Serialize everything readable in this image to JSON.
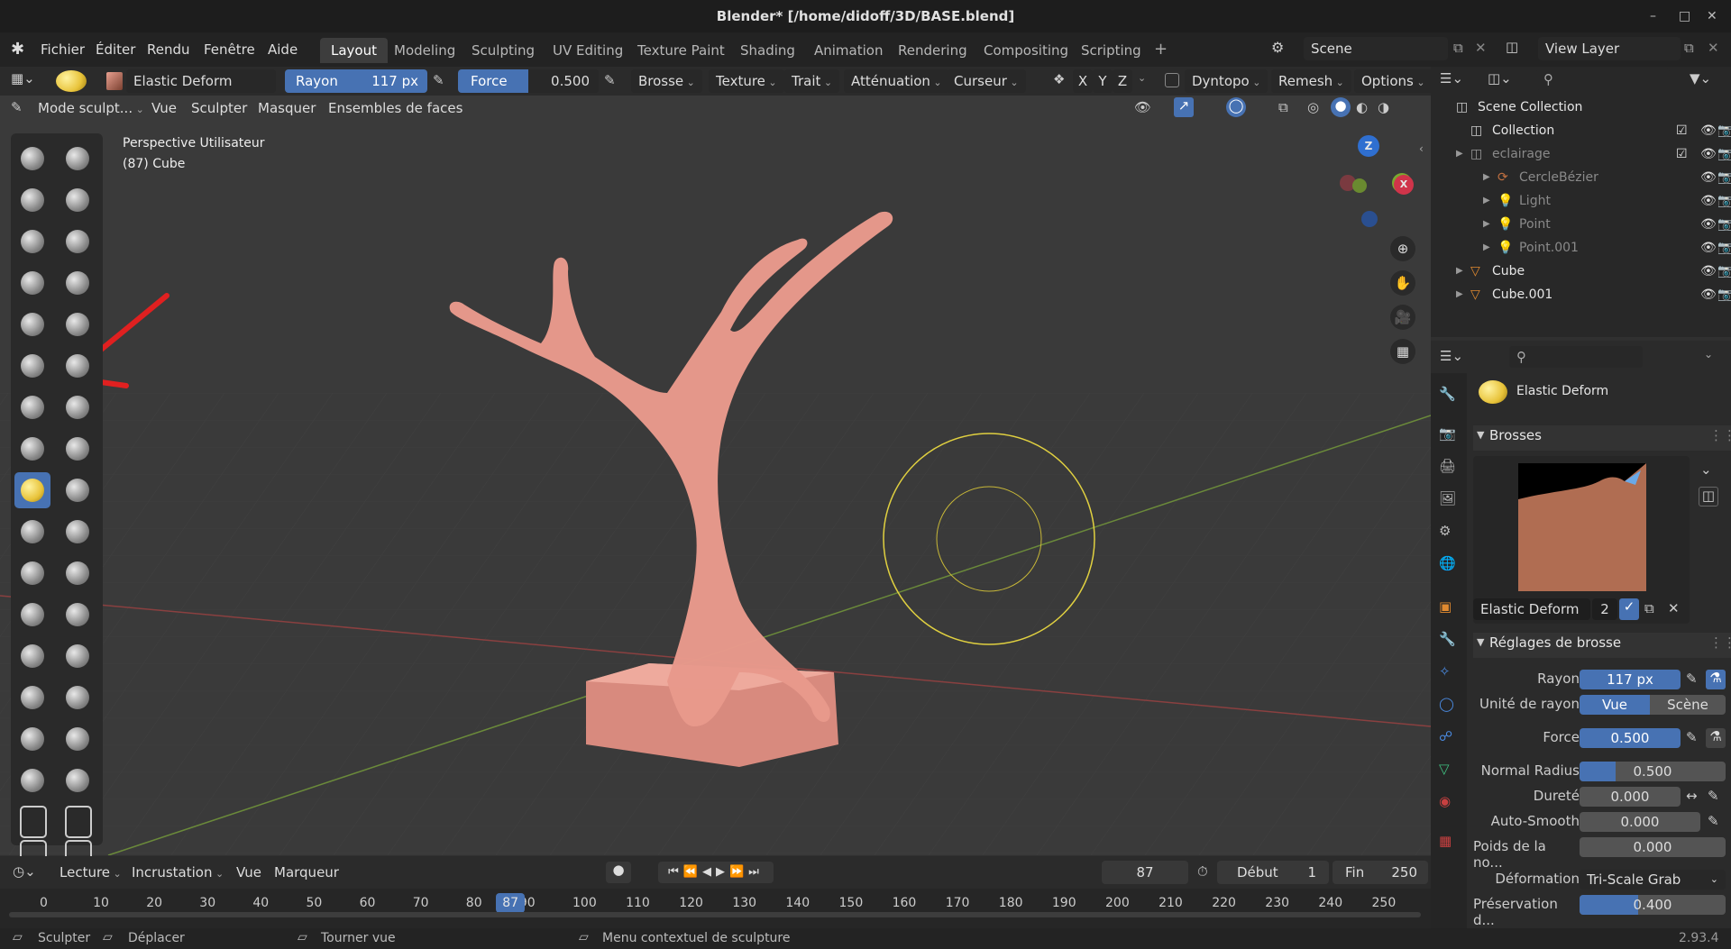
{
  "window": {
    "title": "Blender* [/home/didoff/3D/BASE.blend]",
    "min_icon": "minimize-icon",
    "max_icon": "maximize-icon",
    "close_icon": "close-icon"
  },
  "menu": {
    "items": [
      "Fichier",
      "Éditer",
      "Rendu",
      "Fenêtre",
      "Aide"
    ]
  },
  "workspaces": [
    "Layout",
    "Modeling",
    "Sculpting",
    "UV Editing",
    "Texture Paint",
    "Shading",
    "Animation",
    "Rendering",
    "Compositing",
    "Scripting"
  ],
  "active_workspace": "Layout",
  "scene": {
    "scene_name": "Scene",
    "view_layer": "View Layer"
  },
  "tool_header": {
    "brush_name": "Elastic Deform",
    "rayon_label": "Rayon",
    "rayon_value": "117 px",
    "force_label": "Force",
    "force_value": "0.500",
    "force_fill": 0.5,
    "dropdowns": [
      "Brosse",
      "Texture",
      "Trait",
      "Atténuation",
      "Curseur"
    ],
    "axes": [
      "X",
      "Y",
      "Z"
    ],
    "dyntopo": "Dyntopo",
    "remesh": "Remesh",
    "options": "Options"
  },
  "viewport_header": {
    "mode": "Mode sculpt...",
    "items": [
      "Vue",
      "Sculpter",
      "Masquer",
      "Ensembles de faces"
    ]
  },
  "viewport": {
    "view_name": "Perspective Utilisateur",
    "object_info": "(87) Cube",
    "gizmo": {
      "z": "Z",
      "y": "Y",
      "x": "X"
    }
  },
  "outliner": {
    "rows": [
      {
        "label": "Scene Collection",
        "dim": false
      },
      {
        "label": "Collection",
        "dim": false
      },
      {
        "label": "eclairage",
        "dim": true
      },
      {
        "label": "CercleBézier",
        "dim": true
      },
      {
        "label": "Light",
        "dim": true
      },
      {
        "label": "Point",
        "dim": true
      },
      {
        "label": "Point.001",
        "dim": true
      },
      {
        "label": "Cube",
        "dim": false
      },
      {
        "label": "Cube.001",
        "dim": false
      }
    ]
  },
  "properties": {
    "brush_name": "Elastic Deform",
    "brushes_panel": "Brosses",
    "preview_name": "Elastic Deform",
    "preview_users": "2",
    "settings_panel": "Réglages de brosse",
    "rayon_label": "Rayon",
    "rayon_value": "117 px",
    "radius_unit_label": "Unité de rayon",
    "radius_unit_vue": "Vue",
    "radius_unit_scene": "Scène",
    "force_label": "Force",
    "force_value": "0.500",
    "normal_radius_label": "Normal Radius",
    "normal_radius_value": "0.500",
    "durete_label": "Dureté",
    "durete_value": "0.000",
    "auto_smooth_label": "Auto-Smooth",
    "auto_smooth_value": "0.000",
    "poids_label": "Poids de la no...",
    "poids_value": "0.000",
    "deformation_label": "Déformation",
    "deformation_value": "Tri-Scale Grab",
    "preservation_label": "Préservation d...",
    "preservation_value": "0.400"
  },
  "timeline": {
    "menus": [
      "Lecture",
      "Incrustation",
      "Vue",
      "Marqueur"
    ],
    "current_frame": "87",
    "debut_label": "Début",
    "debut_value": "1",
    "fin_label": "Fin",
    "fin_value": "250",
    "ticks": [
      "0",
      "10",
      "20",
      "30",
      "40",
      "50",
      "60",
      "70",
      "80",
      "90",
      "100",
      "110",
      "120",
      "130",
      "140",
      "150",
      "160",
      "170",
      "180",
      "190",
      "200",
      "210",
      "220",
      "230",
      "240",
      "250"
    ]
  },
  "status": {
    "sculpt": "Sculpter",
    "move": "Déplacer",
    "rotate": "Tourner vue",
    "context": "Menu contextuel de sculpture",
    "version": "2.93.4"
  },
  "colors": {
    "accent": "#4772b3",
    "mesh": "#e8998c",
    "cursor": "#e0d040",
    "brush_sel": "#e8c33a"
  }
}
